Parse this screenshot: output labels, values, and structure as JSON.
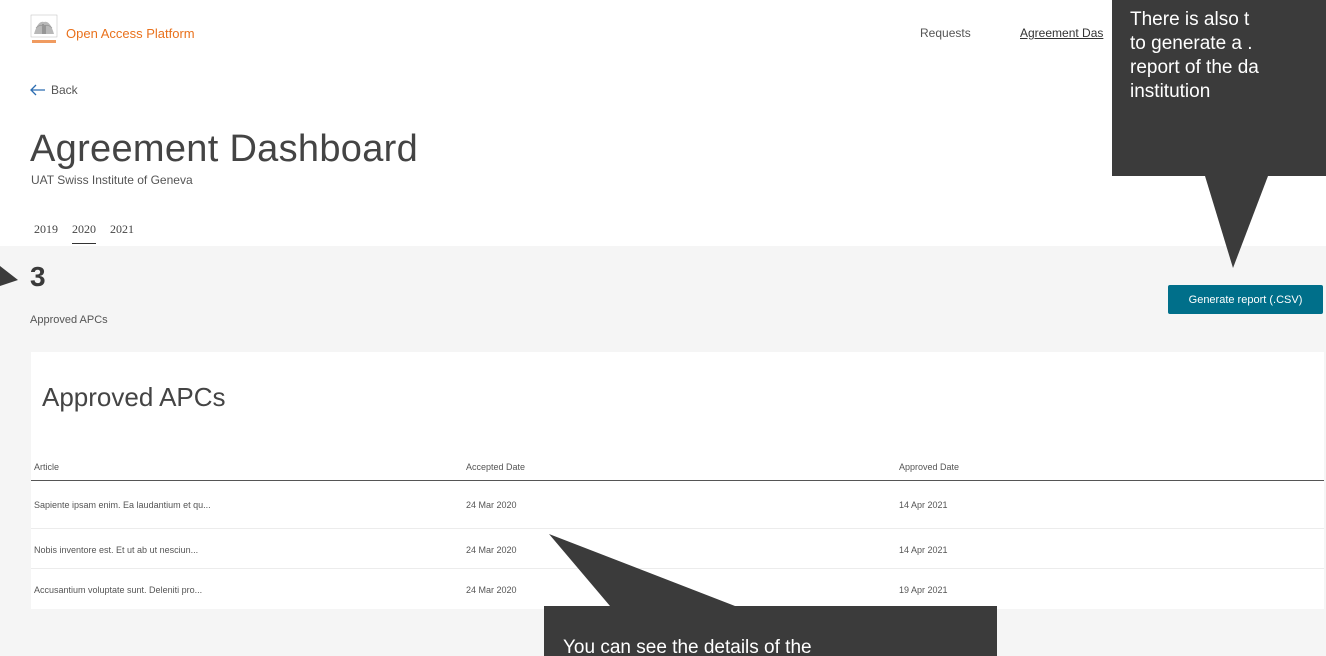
{
  "header": {
    "app_title": "Open Access Platform",
    "logo_icon": "elsevier-logo-icon",
    "nav": [
      {
        "label": "Requests"
      },
      {
        "label": "Agreement Das"
      }
    ]
  },
  "back": {
    "label": "Back",
    "icon": "arrow-left-icon"
  },
  "page": {
    "title": "Agreement Dashboard",
    "subtitle": "UAT Swiss Institute of Geneva"
  },
  "year_tabs": [
    {
      "label": "2019"
    },
    {
      "label": "2020",
      "active": true
    },
    {
      "label": "2021"
    }
  ],
  "summary": {
    "count": "3",
    "label": "Approved APCs",
    "report_button": "Generate report (.CSV)"
  },
  "table": {
    "title": "Approved APCs",
    "columns": [
      "Article",
      "Accepted Date",
      "Approved Date"
    ],
    "rows": [
      [
        "Sapiente ipsam enim. Ea laudantium et qu...",
        "24 Mar 2020",
        "14 Apr 2021"
      ],
      [
        "Nobis inventore est. Et ut ab ut nesciun...",
        "24 Mar 2020",
        "14 Apr 2021"
      ],
      [
        "Accusantium voluptate sunt. Deleniti pro...",
        "24 Mar 2020",
        "19 Apr 2021"
      ]
    ]
  },
  "callouts": {
    "top": [
      "There is also t",
      "to generate a .",
      "report of the da",
      "institution"
    ],
    "bottom": "You can see the details of the"
  },
  "colors": {
    "brand_orange": "#e9711c",
    "button_teal": "#006f8a",
    "callout_bg": "#3b3b3b"
  }
}
